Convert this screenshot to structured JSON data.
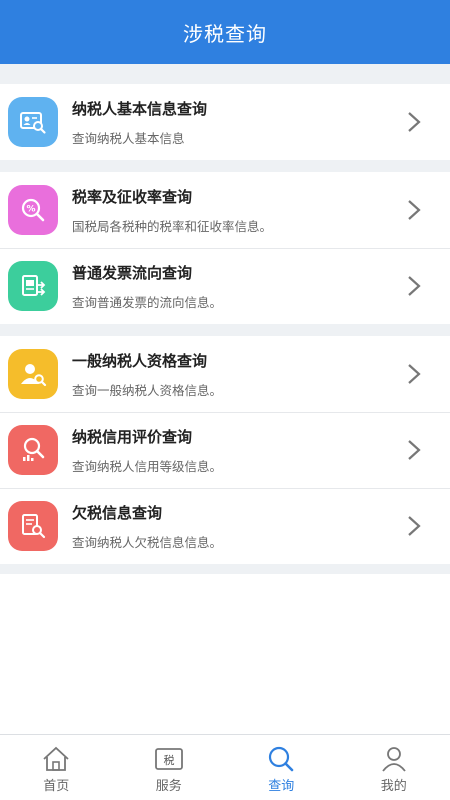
{
  "header": {
    "title": "涉税查询"
  },
  "groups": [
    {
      "items": [
        {
          "title": "纳税人基本信息查询",
          "desc": "查询纳税人基本信息",
          "icon": "id-card-search-icon",
          "color": "#5fb2f0"
        }
      ]
    },
    {
      "items": [
        {
          "title": "税率及征收率查询",
          "desc": "国税局各税种的税率和征收率信息。",
          "icon": "percent-search-icon",
          "color": "#e96fdc"
        },
        {
          "title": "普通发票流向查询",
          "desc": "查询普通发票的流向信息。",
          "icon": "invoice-flow-icon",
          "color": "#3cce9c"
        }
      ]
    },
    {
      "items": [
        {
          "title": "一般纳税人资格查询",
          "desc": "查询一般纳税人资格信息。",
          "icon": "user-search-icon",
          "color": "#f5bd2b"
        },
        {
          "title": "纳税信用评价查询",
          "desc": "查询纳税人信用等级信息。",
          "icon": "credit-chart-search-icon",
          "color": "#f06863"
        },
        {
          "title": "欠税信息查询",
          "desc": "查询纳税人欠税信息信息。",
          "icon": "document-search-icon",
          "color": "#f06863"
        }
      ]
    }
  ],
  "tabbar": {
    "tabs": [
      {
        "label": "首页",
        "icon": "home-icon"
      },
      {
        "label": "服务",
        "icon": "tax-service-icon",
        "glyph": "税"
      },
      {
        "label": "查询",
        "icon": "search-icon",
        "active": true
      },
      {
        "label": "我的",
        "icon": "user-icon"
      }
    ],
    "active_color": "#2f80e0"
  }
}
